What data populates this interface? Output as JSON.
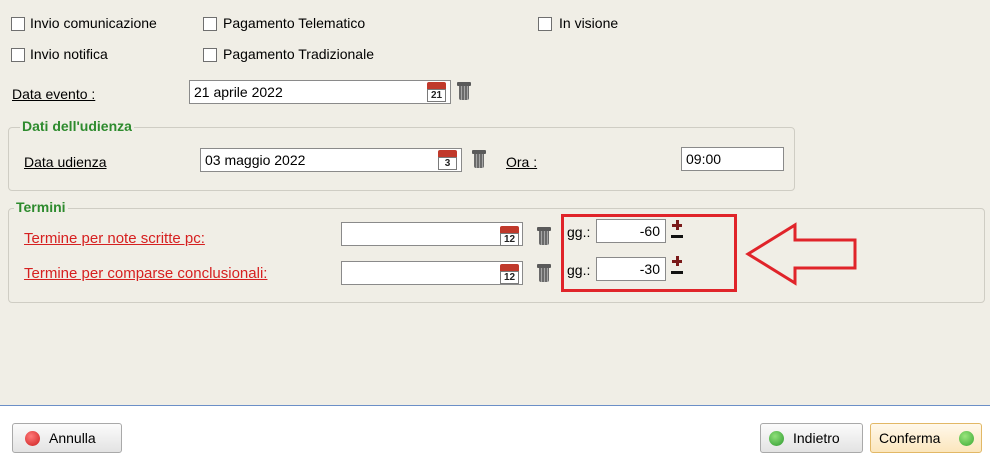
{
  "checkboxes": {
    "invio_comunicazione": "Invio comunicazione",
    "pagamento_telematico": "Pagamento Telematico",
    "in_visione": "In visione",
    "invio_notifica": "Invio notifica",
    "pagamento_tradizionale": "Pagamento Tradizionale"
  },
  "data_evento": {
    "label": "Data evento :",
    "value": "21 aprile 2022",
    "cal_day": "21"
  },
  "udienza": {
    "legend": "Dati dell'udienza",
    "data_label": "Data udienza",
    "data_value": "03 maggio 2022",
    "cal_day": "3",
    "ora_label": "Ora :",
    "ora_value": "09:00"
  },
  "termini": {
    "legend": "Termini",
    "rows": [
      {
        "label": "Termine per note scritte pc:",
        "value": "",
        "cal_day": "12",
        "gg_label": "gg.:",
        "gg_value": "-60"
      },
      {
        "label": "Termine per comparse conclusionali:",
        "value": "",
        "cal_day": "12",
        "gg_label": "gg.:",
        "gg_value": "-30"
      }
    ]
  },
  "buttons": {
    "annulla": "Annulla",
    "indietro": "Indietro",
    "conferma": "Conferma"
  },
  "colors": {
    "annotation_red": "#e0242a",
    "legend_green": "#2e8b2e",
    "field_label_red": "#d62020"
  }
}
